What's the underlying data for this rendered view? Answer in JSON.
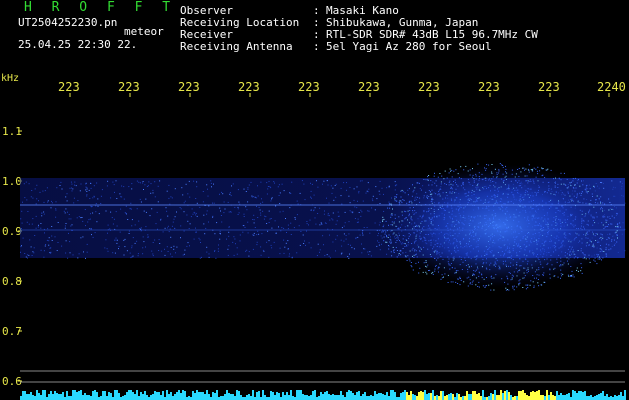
{
  "header": {
    "brand": "H R O F F T",
    "filename": "UT2504252230.pn",
    "meteor_label": "meteor",
    "datetime": "25.04.25 22:30",
    "datetime_suffix": "22."
  },
  "info": {
    "rows": [
      {
        "label": "Observer",
        "value": "Masaki Kano"
      },
      {
        "label": "Receiving Location",
        "value": "Shibukawa, Gunma, Japan"
      },
      {
        "label": "Receiver",
        "value": "RTL-SDR SDR# 43dB L15 96.7MHz CW"
      },
      {
        "label": "Receiving Antenna",
        "value": "5el Yagi Az 280 for Seoul"
      }
    ]
  },
  "axes": {
    "y_unit": "kHz",
    "time_ticks": [
      "223",
      "223",
      "223",
      "223",
      "223",
      "223",
      "223",
      "223",
      "223",
      "2240"
    ],
    "freq_ticks": [
      {
        "label": "1.1",
        "value": 1.1
      },
      {
        "label": "1.0",
        "value": 1.0
      },
      {
        "label": "0.9",
        "value": 0.9
      },
      {
        "label": "0.8",
        "value": 0.8
      },
      {
        "label": "0.7",
        "value": 0.7
      },
      {
        "label": "0.6",
        "value": 0.6
      }
    ]
  },
  "colors": {
    "label_green": "#33dd33",
    "tick_yellow": "#e6e64a",
    "signal_blue": "#2a5cff",
    "strip_cyan": "#2ad8ff",
    "strip_yellow": "#ffff44"
  }
}
